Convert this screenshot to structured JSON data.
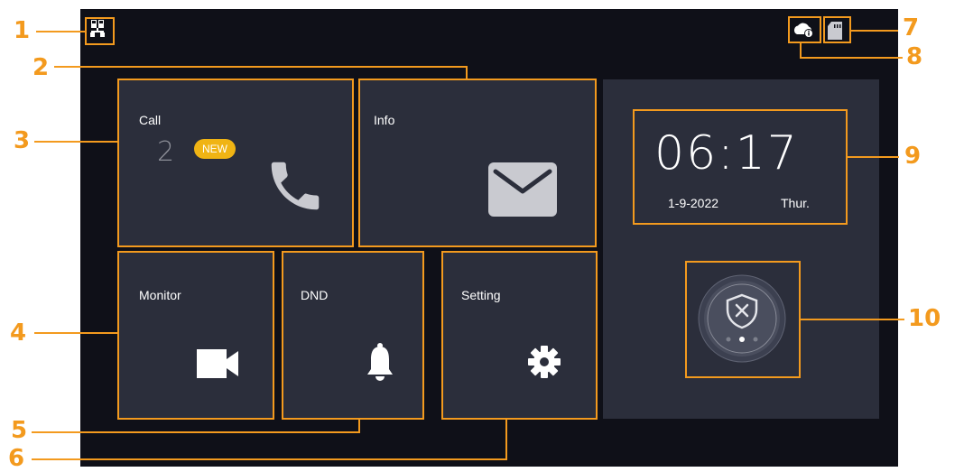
{
  "tiles": {
    "call": {
      "label": "Call",
      "count": "2",
      "badge": "NEW"
    },
    "info": {
      "label": "Info"
    },
    "monitor": {
      "label": "Monitor"
    },
    "dnd": {
      "label": "DND"
    },
    "setting": {
      "label": "Setting"
    }
  },
  "clock": {
    "time": "06:17",
    "date": "1-9-2022",
    "weekday": "Thur."
  },
  "status_icons": [
    "network-icon",
    "cloud-info-icon",
    "sd-card-icon"
  ],
  "arm_widget": {
    "icon": "shield-disarm-icon",
    "page_dots": 3,
    "active_dot": 2
  },
  "callouts": [
    "1",
    "2",
    "3",
    "4",
    "5",
    "6",
    "7",
    "8",
    "9",
    "10"
  ],
  "colors": {
    "accent": "#f39a1e",
    "screen_bg": "#0f1018",
    "tile_bg": "#2b2e3b",
    "badge": "#f0b414"
  }
}
